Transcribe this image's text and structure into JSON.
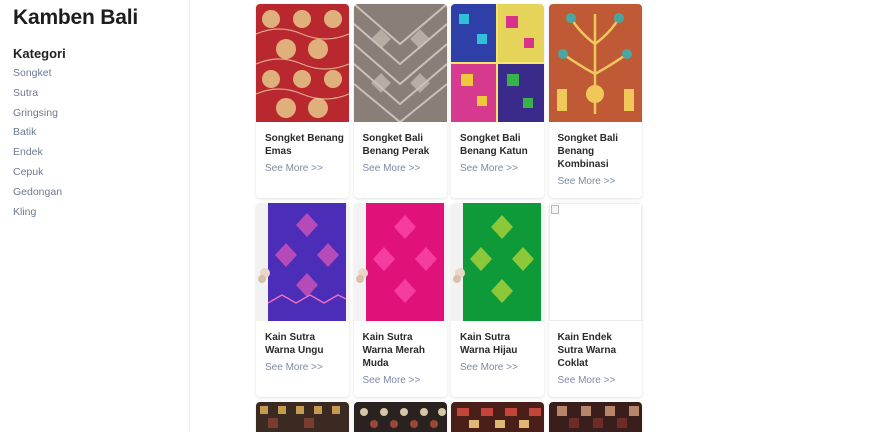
{
  "site": {
    "title": "Kamben Bali"
  },
  "sidebar": {
    "heading": "Kategori",
    "items": [
      {
        "label": "Songket"
      },
      {
        "label": "Sutra"
      },
      {
        "label": "Gringsing"
      },
      {
        "label": "Batik"
      },
      {
        "label": "Endek"
      },
      {
        "label": "Cepuk"
      },
      {
        "label": "Gedongan"
      },
      {
        "label": "Kling"
      }
    ]
  },
  "products": [
    {
      "title": "Songket Benang Emas",
      "link": "See More >>"
    },
    {
      "title": "Songket Bali Benang Perak",
      "link": "See More >>"
    },
    {
      "title": "Songket Bali Benang Katun",
      "link": "See More >>"
    },
    {
      "title": "Songket Bali Benang Kombinasi",
      "link": "See More >>"
    },
    {
      "title": "Kain Sutra Warna Ungu",
      "link": "See More >>"
    },
    {
      "title": "Kain Sutra Warna Merah Muda",
      "link": "See More >>"
    },
    {
      "title": "Kain Sutra Warna Hijau",
      "link": "See More >>"
    },
    {
      "title": "Kain Endek Sutra Warna Coklat",
      "link": "See More >>"
    }
  ],
  "colors": {
    "link": "#7d8aa3",
    "sidebar_link": "#6c7a93"
  }
}
